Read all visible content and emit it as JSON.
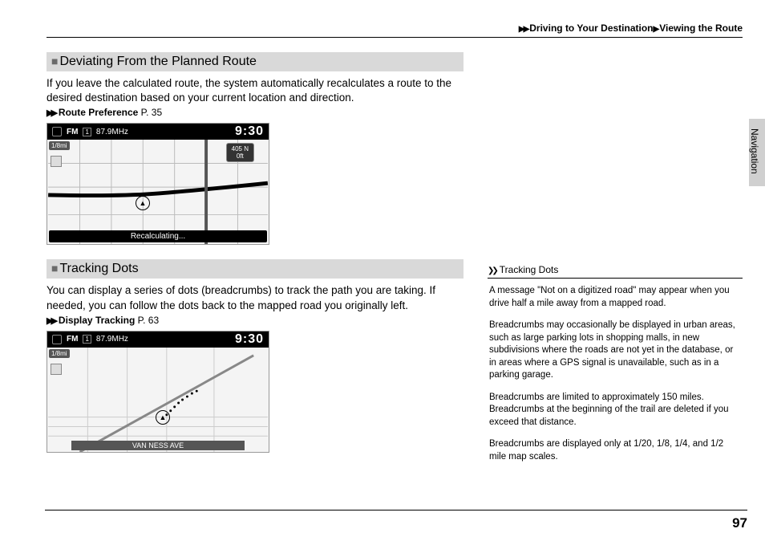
{
  "breadcrumb": {
    "level1": "Driving to Your Destination",
    "level2": "Viewing the Route"
  },
  "side_tab_label": "Navigation",
  "sections": {
    "deviating": {
      "heading": "Deviating From the Planned Route",
      "body": "If you leave the calculated route, the system automatically recalculates a route to the desired destination based on your current location and direction.",
      "xref_label": "Route Preference",
      "xref_page": "P. 35"
    },
    "tracking": {
      "heading": "Tracking Dots",
      "body": "You can display a series of dots (breadcrumbs) to track the path you are taking. If needed, you can follow the dots back to the mapped road you originally left.",
      "xref_label": "Display Tracking",
      "xref_page": "P. 63"
    }
  },
  "map1": {
    "fm_label": "FM",
    "freq": "87.9MHz",
    "clock": "9:30",
    "scale": "1/8mi",
    "sign_route": "405 N",
    "sign_dist": "0ft",
    "recalc": "Recalculating..."
  },
  "map2": {
    "fm_label": "FM",
    "freq": "87.9MHz",
    "clock": "9:30",
    "scale": "1/8mi",
    "street": "VAN NESS AVE"
  },
  "sidebar": {
    "heading": "Tracking Dots",
    "p1": "A message \"Not on a digitized road\" may appear when you drive half a mile away from a mapped road.",
    "p2": "Breadcrumbs may occasionally be displayed in urban areas, such as large parking lots in shopping malls, in new subdivisions where the roads are not yet in the database, or in areas where a GPS signal is unavailable, such as in a parking garage.",
    "p3": "Breadcrumbs are limited to approximately 150 miles. Breadcrumbs at the beginning of the trail are deleted if you exceed that distance.",
    "p4": "Breadcrumbs are displayed only at 1/20, 1/8, 1/4, and 1/2 mile map scales."
  },
  "page_number": "97"
}
